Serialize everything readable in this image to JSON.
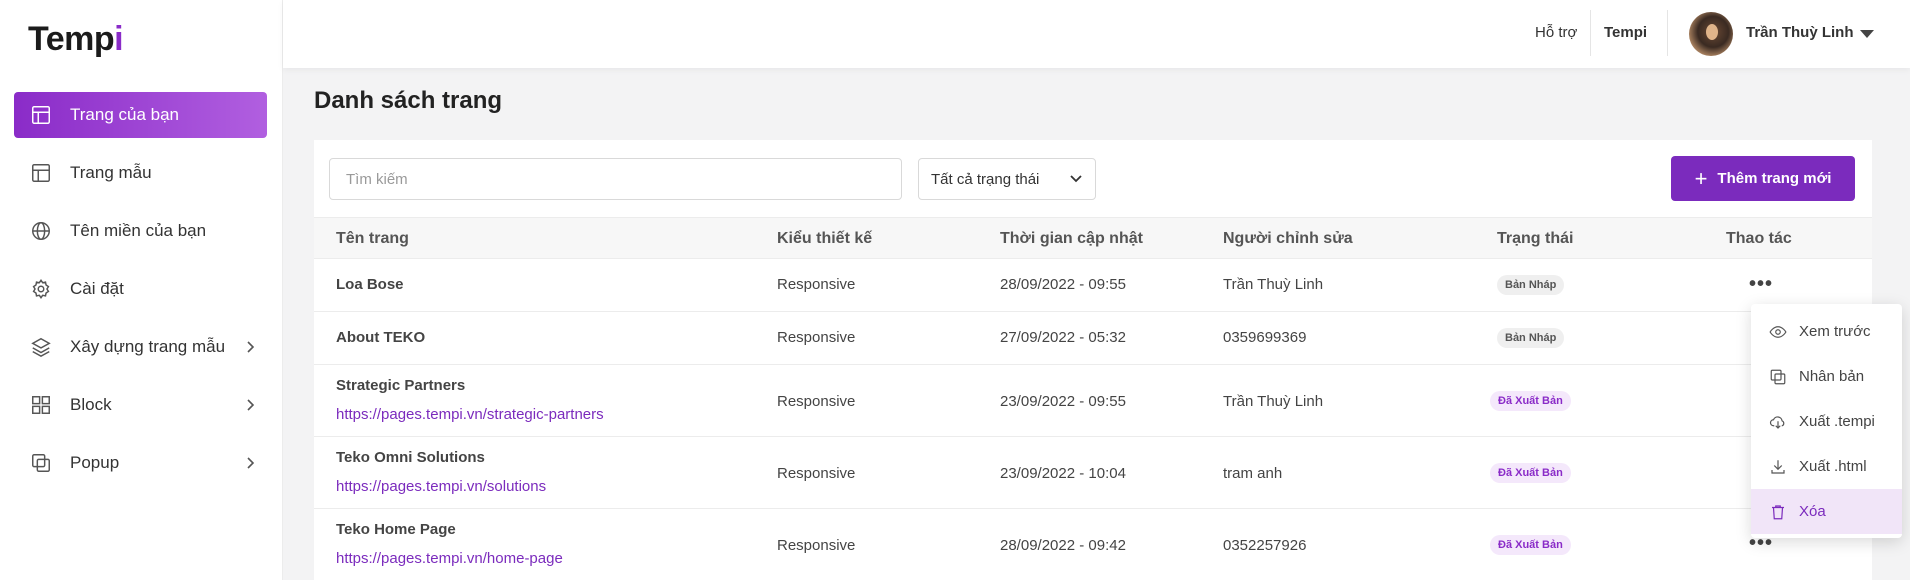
{
  "logo": {
    "text_main": "Temp",
    "text_accent": "i"
  },
  "sidebar": {
    "items": [
      {
        "label": "Trang của bạn",
        "icon": "layout-icon",
        "active": true,
        "has_chevron": false
      },
      {
        "label": "Trang mẫu",
        "icon": "template-icon",
        "active": false,
        "has_chevron": false
      },
      {
        "label": "Tên miền của bạn",
        "icon": "globe-icon",
        "active": false,
        "has_chevron": false
      },
      {
        "label": "Cài đặt",
        "icon": "gear-icon",
        "active": false,
        "has_chevron": false
      },
      {
        "label": "Xây dựng trang mẫu",
        "icon": "layers-icon",
        "active": false,
        "has_chevron": true
      },
      {
        "label": "Block",
        "icon": "grid-icon",
        "active": false,
        "has_chevron": true
      },
      {
        "label": "Popup",
        "icon": "popup-icon",
        "active": false,
        "has_chevron": true
      }
    ]
  },
  "header": {
    "support": "Hỗ trợ",
    "brand": "Tempi",
    "user_name": "Trần Thuỳ Linh"
  },
  "main": {
    "title": "Danh sách trang",
    "search_placeholder": "Tìm kiếm",
    "status_filter": "Tất cả trạng thái",
    "add_button": "Thêm trang mới",
    "columns": [
      "Tên trang",
      "Kiểu thiết kế",
      "Thời gian cập nhật",
      "Người chỉnh sửa",
      "Trạng thái",
      "Thao tác"
    ],
    "rows": [
      {
        "name": "Loa Bose",
        "url": "",
        "design": "Responsive",
        "updated": "28/09/2022 - 09:55",
        "editor": "Trần Thuỳ Linh",
        "status": "Bản Nháp",
        "status_type": "draft",
        "actions": "•••"
      },
      {
        "name": "About TEKO",
        "url": "",
        "design": "Responsive",
        "updated": "27/09/2022 - 05:32",
        "editor": "0359699369",
        "status": "Bản Nháp",
        "status_type": "draft",
        "actions": ""
      },
      {
        "name": "Strategic Partners",
        "url": "https://pages.tempi.vn/strategic-partners",
        "design": "Responsive",
        "updated": "23/09/2022 - 09:55",
        "editor": "Trần Thuỳ Linh",
        "status": "Đã Xuất Bản",
        "status_type": "published",
        "actions": ""
      },
      {
        "name": "Teko Omni Solutions",
        "url": "https://pages.tempi.vn/solutions",
        "design": "Responsive",
        "updated": "23/09/2022 - 10:04",
        "editor": "tram anh",
        "status": "Đã Xuất Bản",
        "status_type": "published",
        "actions": ""
      },
      {
        "name": "Teko Home Page",
        "url": "https://pages.tempi.vn/home-page",
        "design": "Responsive",
        "updated": "28/09/2022 - 09:42",
        "editor": "0352257926",
        "status": "Đã Xuất Bản",
        "status_type": "published",
        "actions": "•••"
      }
    ]
  },
  "actions_menu": {
    "items": [
      {
        "label": "Xem trước",
        "icon": "eye-icon"
      },
      {
        "label": "Nhân bản",
        "icon": "copy-icon"
      },
      {
        "label": "Xuất .tempi",
        "icon": "cloud-download-icon"
      },
      {
        "label": "Xuất .html",
        "icon": "download-icon"
      },
      {
        "label": "Xóa",
        "icon": "trash-icon",
        "highlighted": true
      }
    ]
  },
  "colors": {
    "brand_purple": "#7b2bbd",
    "active_gradient_start": "#8a2bc8",
    "active_gradient_end": "#b15fe0",
    "draft_badge_bg": "#efefef",
    "published_badge_bg": "#f4e8fb"
  }
}
